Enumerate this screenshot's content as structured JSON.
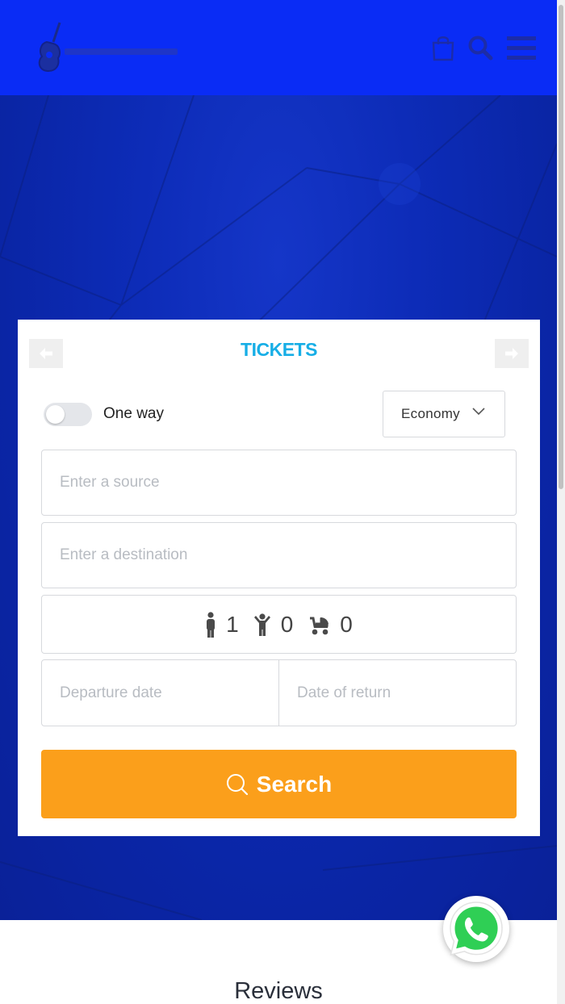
{
  "header": {
    "background_color": "#0a2cf5",
    "logo_icon": "guitar-logo-icon",
    "cart_icon": "shopping-bag-icon",
    "search_icon": "search-icon",
    "menu_icon": "hamburger-menu-icon"
  },
  "ticket_form": {
    "title": "TICKETS",
    "prev_icon": "arrow-left-icon",
    "next_icon": "arrow-right-icon",
    "trip_toggle_label": "One way",
    "trip_toggle_on": false,
    "class_value": "Economy",
    "source_placeholder": "Enter a source",
    "destination_placeholder": "Enter a destination",
    "passengers": {
      "adults": "1",
      "children": "0",
      "infants": "0",
      "adult_icon": "person-icon",
      "child_icon": "child-icon",
      "infant_icon": "stroller-icon"
    },
    "departure_placeholder": "Departure date",
    "return_placeholder": "Date of return",
    "search_label": "Search",
    "search_color": "#fb9f1b",
    "title_color": "#17aee6"
  },
  "whatsapp_icon": "whatsapp-icon",
  "reviews": {
    "title": "Reviews"
  }
}
